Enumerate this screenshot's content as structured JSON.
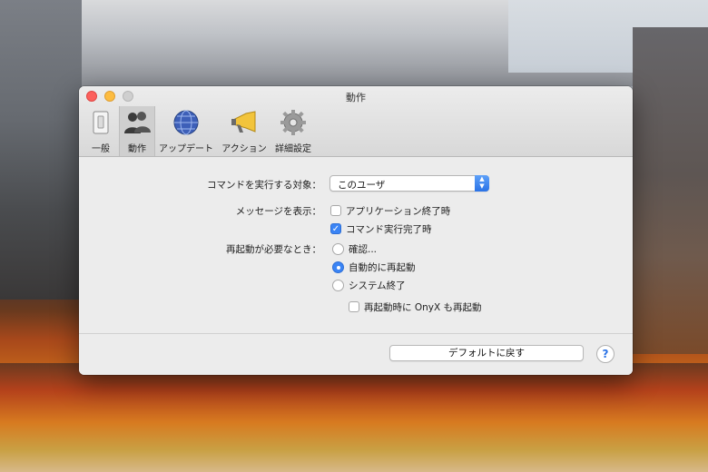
{
  "window": {
    "title": "動作"
  },
  "toolbar": {
    "tabs": [
      {
        "label": "一般",
        "icon": "switch-icon",
        "active": false
      },
      {
        "label": "動作",
        "icon": "people-icon",
        "active": true
      },
      {
        "label": "アップデート",
        "icon": "globe-icon",
        "active": false
      },
      {
        "label": "アクション",
        "icon": "megaphone-icon",
        "active": false
      },
      {
        "label": "詳細設定",
        "icon": "gear-icon",
        "active": false
      }
    ]
  },
  "settings": {
    "target_label": "コマンドを実行する対象：",
    "target_value": "このユーザ",
    "message_label": "メッセージを表示：",
    "message_options": [
      {
        "label": "アプリケーション終了時",
        "checked": false
      },
      {
        "label": "コマンド実行完了時",
        "checked": true
      }
    ],
    "restart_label": "再起動が必要なとき：",
    "restart_options": [
      {
        "label": "確認...",
        "selected": false
      },
      {
        "label": "自動的に再起動",
        "selected": true
      },
      {
        "label": "システム終了",
        "selected": false
      }
    ],
    "relaunch_label": "再起動時に OnyX も再起動",
    "relaunch_checked": false
  },
  "footer": {
    "default_button": "デフォルトに戻す",
    "help_glyph": "?"
  },
  "colors": {
    "accent": "#3a84f5",
    "close": "#fc605c",
    "minimize": "#fdbc40",
    "zoom": "#cfcfcf"
  }
}
